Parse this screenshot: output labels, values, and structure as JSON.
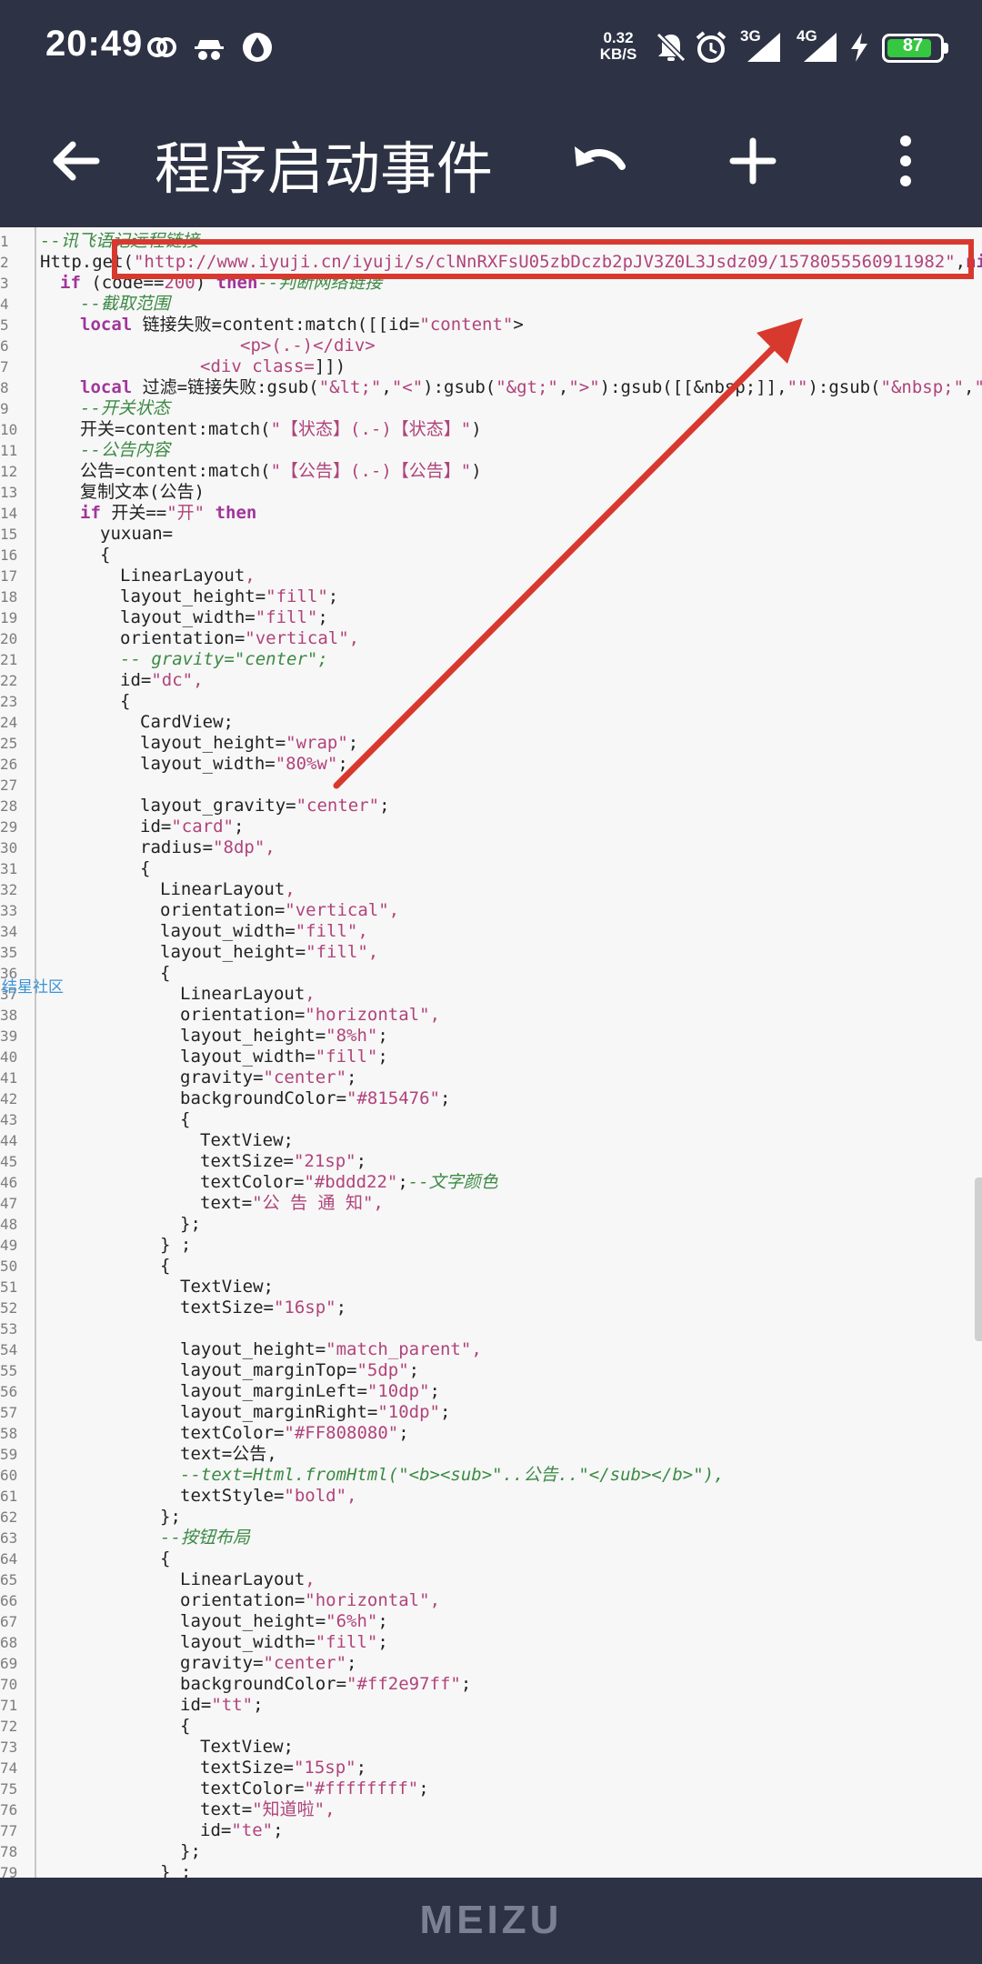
{
  "status_bar": {
    "time": "20:49",
    "net_speed_value": "0.32",
    "net_speed_unit": "KB/S",
    "signal1_label": "3G",
    "signal2_label": "4G",
    "battery": "87",
    "battery_level": 0.87,
    "battery_color": "#35c840"
  },
  "app_bar": {
    "title": "程序启动事件",
    "back_icon": "arrow-left-icon",
    "undo_icon": "undo-icon",
    "add_icon": "plus-icon",
    "more_icon": "more-vertical-icon"
  },
  "watermark": "结星社区",
  "bottom_brand": "MEIZU",
  "code_lines": [
    {
      "n": "1",
      "i": 0,
      "parts": [
        [
          "cm",
          "--讯飞语记远程链接"
        ]
      ]
    },
    {
      "n": "2",
      "i": 0,
      "parts": [
        [
          "t",
          "Http.get("
        ],
        [
          "str",
          "\"http://www.iyuji.cn/iyuji/s/clNnRXFsU05zbDczb2pJV3Z0L3Jsdz09/1578055560911982\""
        ],
        [
          "t",
          ","
        ],
        [
          "kw",
          "nil"
        ],
        [
          "t",
          ",n"
        ]
      ]
    },
    {
      "n": "3",
      "i": 1,
      "parts": [
        [
          "kw",
          "if"
        ],
        [
          "t",
          " (code=="
        ],
        [
          "str",
          "200"
        ],
        [
          "t",
          ") "
        ],
        [
          "kw",
          "then"
        ],
        [
          "cm",
          "--判断网络链接"
        ]
      ]
    },
    {
      "n": "4",
      "i": 2,
      "parts": [
        [
          "cm",
          "--截取范围"
        ]
      ]
    },
    {
      "n": "5",
      "i": 2,
      "parts": [
        [
          "kw",
          "local"
        ],
        [
          "t",
          " 链接失败=content:match([[id="
        ],
        [
          "str",
          "\"content\""
        ],
        [
          "t",
          ">"
        ]
      ]
    },
    {
      "n": "6",
      "i": 10,
      "parts": [
        [
          "str",
          "<p>(.-)</div>"
        ]
      ]
    },
    {
      "n": "7",
      "i": 8,
      "parts": [
        [
          "str",
          "<div class="
        ],
        [
          "t",
          "]])"
        ]
      ]
    },
    {
      "n": "8",
      "i": 2,
      "parts": [
        [
          "kw",
          "local"
        ],
        [
          "t",
          " 过滤=链接失败:gsub("
        ],
        [
          "str",
          "\"&lt;\""
        ],
        [
          "t",
          ","
        ],
        [
          "str",
          "\"<\""
        ],
        [
          "t",
          "):gsub("
        ],
        [
          "str",
          "\"&gt;\""
        ],
        [
          "t",
          ","
        ],
        [
          "str",
          "\">\""
        ],
        [
          "t",
          "):gsub([[&nbsp;"
        ],
        [
          "t",
          "]],"
        ],
        [
          "str",
          "\"\""
        ],
        [
          "t",
          "):gsub("
        ],
        [
          "str",
          "\"&nbsp;\""
        ],
        [
          "t",
          ","
        ],
        [
          "str",
          "\"\""
        ],
        [
          "t",
          ")"
        ]
      ]
    },
    {
      "n": "9",
      "i": 2,
      "parts": [
        [
          "cm",
          "--开关状态"
        ]
      ]
    },
    {
      "n": "10",
      "i": 2,
      "parts": [
        [
          "t",
          "开关=content:match("
        ],
        [
          "str",
          "\"【状态】(.-)【状态】\""
        ],
        [
          "t",
          ")"
        ]
      ]
    },
    {
      "n": "11",
      "i": 2,
      "parts": [
        [
          "cm",
          "--公告内容"
        ]
      ]
    },
    {
      "n": "12",
      "i": 2,
      "parts": [
        [
          "t",
          "公告=content:match("
        ],
        [
          "str",
          "\"【公告】(.-)【公告】\""
        ],
        [
          "t",
          ")"
        ]
      ]
    },
    {
      "n": "13",
      "i": 2,
      "parts": [
        [
          "t",
          "复制文本(公告)"
        ]
      ]
    },
    {
      "n": "14",
      "i": 2,
      "parts": [
        [
          "kw",
          "if"
        ],
        [
          "t",
          " 开关=="
        ],
        [
          "str",
          "\"开\""
        ],
        [
          "t",
          " "
        ],
        [
          "kw",
          "then"
        ]
      ]
    },
    {
      "n": "15",
      "i": 3,
      "parts": [
        [
          "t",
          "yuxuan="
        ]
      ]
    },
    {
      "n": "16",
      "i": 3,
      "parts": [
        [
          "t",
          "{"
        ]
      ]
    },
    {
      "n": "17",
      "i": 4,
      "parts": [
        [
          "t",
          "LinearLayout"
        ],
        [
          "str",
          ","
        ]
      ]
    },
    {
      "n": "18",
      "i": 4,
      "parts": [
        [
          "t",
          "layout_height="
        ],
        [
          "str",
          "\"fill\""
        ],
        [
          "t",
          ";"
        ]
      ]
    },
    {
      "n": "19",
      "i": 4,
      "parts": [
        [
          "t",
          "layout_width="
        ],
        [
          "str",
          "\"fill\""
        ],
        [
          "t",
          ";"
        ]
      ]
    },
    {
      "n": "20",
      "i": 4,
      "parts": [
        [
          "t",
          "orientation="
        ],
        [
          "str",
          "\"vertical\""
        ],
        [
          "str",
          ","
        ]
      ]
    },
    {
      "n": "21",
      "i": 4,
      "parts": [
        [
          "cm",
          "-- gravity=\"center\";"
        ]
      ]
    },
    {
      "n": "22",
      "i": 4,
      "parts": [
        [
          "t",
          "id="
        ],
        [
          "str",
          "\"dc\""
        ],
        [
          "str",
          ","
        ]
      ]
    },
    {
      "n": "23",
      "i": 4,
      "parts": [
        [
          "t",
          "{"
        ]
      ]
    },
    {
      "n": "24",
      "i": 5,
      "parts": [
        [
          "t",
          "CardView;"
        ]
      ]
    },
    {
      "n": "25",
      "i": 5,
      "parts": [
        [
          "t",
          "layout_height="
        ],
        [
          "str",
          "\"wrap\""
        ],
        [
          "t",
          ";"
        ]
      ]
    },
    {
      "n": "26",
      "i": 5,
      "parts": [
        [
          "t",
          "layout_width="
        ],
        [
          "str",
          "\"80%w\""
        ],
        [
          "t",
          ";"
        ]
      ]
    },
    {
      "n": "27",
      "i": 5,
      "parts": []
    },
    {
      "n": "28",
      "i": 5,
      "parts": [
        [
          "t",
          "layout_gravity="
        ],
        [
          "str",
          "\"center\""
        ],
        [
          "t",
          ";"
        ]
      ]
    },
    {
      "n": "29",
      "i": 5,
      "parts": [
        [
          "t",
          "id="
        ],
        [
          "str",
          "\"card\""
        ],
        [
          "t",
          ";"
        ]
      ]
    },
    {
      "n": "30",
      "i": 5,
      "parts": [
        [
          "t",
          "radius="
        ],
        [
          "str",
          "\"8dp\""
        ],
        [
          "str",
          ","
        ]
      ]
    },
    {
      "n": "31",
      "i": 5,
      "parts": [
        [
          "t",
          "{"
        ]
      ]
    },
    {
      "n": "32",
      "i": 6,
      "parts": [
        [
          "t",
          "LinearLayout"
        ],
        [
          "str",
          ","
        ]
      ]
    },
    {
      "n": "33",
      "i": 6,
      "parts": [
        [
          "t",
          "orientation="
        ],
        [
          "str",
          "\"vertical\""
        ],
        [
          "str",
          ","
        ]
      ]
    },
    {
      "n": "34",
      "i": 6,
      "parts": [
        [
          "t",
          "layout_width="
        ],
        [
          "str",
          "\"fill\""
        ],
        [
          "str",
          ","
        ]
      ]
    },
    {
      "n": "35",
      "i": 6,
      "parts": [
        [
          "t",
          "layout_height="
        ],
        [
          "str",
          "\"fill\""
        ],
        [
          "str",
          ","
        ]
      ]
    },
    {
      "n": "36",
      "i": 6,
      "parts": [
        [
          "t",
          "{"
        ]
      ]
    },
    {
      "n": "37",
      "i": 7,
      "parts": [
        [
          "t",
          "LinearLayout"
        ],
        [
          "str",
          ","
        ]
      ]
    },
    {
      "n": "38",
      "i": 7,
      "parts": [
        [
          "t",
          "orientation="
        ],
        [
          "str",
          "\"horizontal\""
        ],
        [
          "str",
          ","
        ]
      ]
    },
    {
      "n": "39",
      "i": 7,
      "parts": [
        [
          "t",
          "layout_height="
        ],
        [
          "str",
          "\"8%h\""
        ],
        [
          "t",
          ";"
        ]
      ]
    },
    {
      "n": "40",
      "i": 7,
      "parts": [
        [
          "t",
          "layout_width="
        ],
        [
          "str",
          "\"fill\""
        ],
        [
          "t",
          ";"
        ]
      ]
    },
    {
      "n": "41",
      "i": 7,
      "parts": [
        [
          "t",
          "gravity="
        ],
        [
          "str",
          "\"center\""
        ],
        [
          "t",
          ";"
        ]
      ]
    },
    {
      "n": "42",
      "i": 7,
      "parts": [
        [
          "t",
          "backgroundColor="
        ],
        [
          "str",
          "\"#815476\""
        ],
        [
          "t",
          ";"
        ]
      ]
    },
    {
      "n": "43",
      "i": 7,
      "parts": [
        [
          "t",
          "{"
        ]
      ]
    },
    {
      "n": "44",
      "i": 8,
      "parts": [
        [
          "t",
          "TextView;"
        ]
      ]
    },
    {
      "n": "45",
      "i": 8,
      "parts": [
        [
          "t",
          "textSize="
        ],
        [
          "str",
          "\"21sp\""
        ],
        [
          "t",
          ";"
        ]
      ]
    },
    {
      "n": "46",
      "i": 8,
      "parts": [
        [
          "t",
          "textColor="
        ],
        [
          "str",
          "\"#bddd22\""
        ],
        [
          "t",
          ";"
        ],
        [
          "cm",
          "--文字颜色"
        ]
      ]
    },
    {
      "n": "47",
      "i": 8,
      "parts": [
        [
          "t",
          "text="
        ],
        [
          "str",
          "\"公 告 通 知\""
        ],
        [
          "str",
          ","
        ]
      ]
    },
    {
      "n": "48",
      "i": 7,
      "parts": [
        [
          "t",
          "};"
        ]
      ]
    },
    {
      "n": "49",
      "i": 6,
      "parts": [
        [
          "t",
          "} ;"
        ]
      ]
    },
    {
      "n": "50",
      "i": 6,
      "parts": [
        [
          "t",
          "{"
        ]
      ]
    },
    {
      "n": "51",
      "i": 7,
      "parts": [
        [
          "t",
          "TextView;"
        ]
      ]
    },
    {
      "n": "52",
      "i": 7,
      "parts": [
        [
          "t",
          "textSize="
        ],
        [
          "str",
          "\"16sp\""
        ],
        [
          "t",
          ";"
        ]
      ]
    },
    {
      "n": "53",
      "i": 7,
      "parts": []
    },
    {
      "n": "54",
      "i": 7,
      "parts": [
        [
          "t",
          "layout_height="
        ],
        [
          "str",
          "\"match_parent\""
        ],
        [
          "str",
          ","
        ]
      ]
    },
    {
      "n": "55",
      "i": 7,
      "parts": [
        [
          "t",
          "layout_marginTop="
        ],
        [
          "str",
          "\"5dp\""
        ],
        [
          "t",
          ";"
        ]
      ]
    },
    {
      "n": "56",
      "i": 7,
      "parts": [
        [
          "t",
          "layout_marginLeft="
        ],
        [
          "str",
          "\"10dp\""
        ],
        [
          "t",
          ";"
        ]
      ]
    },
    {
      "n": "57",
      "i": 7,
      "parts": [
        [
          "t",
          "layout_marginRight="
        ],
        [
          "str",
          "\"10dp\""
        ],
        [
          "t",
          ";"
        ]
      ]
    },
    {
      "n": "58",
      "i": 7,
      "parts": [
        [
          "t",
          "textColor="
        ],
        [
          "str",
          "\"#FF808080\""
        ],
        [
          "t",
          ";"
        ]
      ]
    },
    {
      "n": "59",
      "i": 7,
      "parts": [
        [
          "t",
          "text=公告,"
        ]
      ]
    },
    {
      "n": "60",
      "i": 7,
      "parts": [
        [
          "cm",
          "--text=Html.fromHtml(\"<b><sub>\"..公告..\"</sub></b>\"),"
        ]
      ]
    },
    {
      "n": "61",
      "i": 7,
      "parts": [
        [
          "t",
          "textStyle="
        ],
        [
          "str",
          "\"bold\""
        ],
        [
          "str",
          ","
        ]
      ]
    },
    {
      "n": "62",
      "i": 6,
      "parts": [
        [
          "t",
          "};"
        ]
      ]
    },
    {
      "n": "63",
      "i": 6,
      "parts": [
        [
          "cm",
          "--按钮布局"
        ]
      ]
    },
    {
      "n": "64",
      "i": 6,
      "parts": [
        [
          "t",
          "{"
        ]
      ]
    },
    {
      "n": "65",
      "i": 7,
      "parts": [
        [
          "t",
          "LinearLayout"
        ],
        [
          "str",
          ","
        ]
      ]
    },
    {
      "n": "66",
      "i": 7,
      "parts": [
        [
          "t",
          "orientation="
        ],
        [
          "str",
          "\"horizontal\""
        ],
        [
          "str",
          ","
        ]
      ]
    },
    {
      "n": "67",
      "i": 7,
      "parts": [
        [
          "t",
          "layout_height="
        ],
        [
          "str",
          "\"6%h\""
        ],
        [
          "t",
          ";"
        ]
      ]
    },
    {
      "n": "68",
      "i": 7,
      "parts": [
        [
          "t",
          "layout_width="
        ],
        [
          "str",
          "\"fill\""
        ],
        [
          "t",
          ";"
        ]
      ]
    },
    {
      "n": "69",
      "i": 7,
      "parts": [
        [
          "t",
          "gravity="
        ],
        [
          "str",
          "\"center\""
        ],
        [
          "t",
          ";"
        ]
      ]
    },
    {
      "n": "70",
      "i": 7,
      "parts": [
        [
          "t",
          "backgroundColor="
        ],
        [
          "str",
          "\"#ff2e97ff\""
        ],
        [
          "t",
          ";"
        ]
      ]
    },
    {
      "n": "71",
      "i": 7,
      "parts": [
        [
          "t",
          "id="
        ],
        [
          "str",
          "\"tt\""
        ],
        [
          "t",
          ";"
        ]
      ]
    },
    {
      "n": "72",
      "i": 7,
      "parts": [
        [
          "t",
          "{"
        ]
      ]
    },
    {
      "n": "73",
      "i": 8,
      "parts": [
        [
          "t",
          "TextView;"
        ]
      ]
    },
    {
      "n": "74",
      "i": 8,
      "parts": [
        [
          "t",
          "textSize="
        ],
        [
          "str",
          "\"15sp\""
        ],
        [
          "t",
          ";"
        ]
      ]
    },
    {
      "n": "75",
      "i": 8,
      "parts": [
        [
          "t",
          "textColor="
        ],
        [
          "str",
          "\"#ffffffff\""
        ],
        [
          "t",
          ";"
        ]
      ]
    },
    {
      "n": "76",
      "i": 8,
      "parts": [
        [
          "t",
          "text="
        ],
        [
          "str",
          "\"知道啦\""
        ],
        [
          "str",
          ","
        ]
      ]
    },
    {
      "n": "77",
      "i": 8,
      "parts": [
        [
          "t",
          "id="
        ],
        [
          "str",
          "\"te\""
        ],
        [
          "t",
          ";"
        ]
      ]
    },
    {
      "n": "78",
      "i": 7,
      "parts": [
        [
          "t",
          "};"
        ]
      ]
    },
    {
      "n": "79",
      "i": 6,
      "parts": [
        [
          "t",
          "} ;"
        ]
      ]
    }
  ]
}
